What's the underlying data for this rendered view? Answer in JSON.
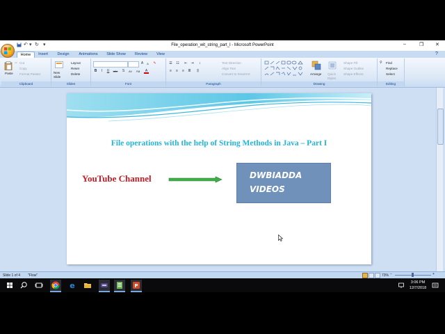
{
  "window": {
    "title": "File_operation_wit_string_part_I - Microsoft PowerPoint",
    "controls": {
      "minimize": "–",
      "maximize": "❐",
      "close": "✕"
    }
  },
  "tabs": [
    "Home",
    "Insert",
    "Design",
    "Animations",
    "Slide Show",
    "Review",
    "View"
  ],
  "ribbon": {
    "clipboard": {
      "label": "Clipboard",
      "paste": "Paste",
      "cut": "Cut",
      "copy": "Copy",
      "format_painter": "Format Painter"
    },
    "slides": {
      "label": "Slides",
      "new_slide": "New Slide",
      "layout": "Layout",
      "reset": "Reset",
      "delete": "Delete"
    },
    "font": {
      "label": "Font",
      "bold": "B",
      "italic": "I",
      "underline": "U",
      "strike": "abe",
      "shadow": "S",
      "spacing": "AV",
      "case": "Aa",
      "grow": "A",
      "shrink": "A"
    },
    "paragraph": {
      "label": "Paragraph",
      "text_direction": "Text Direction",
      "align_text": "Align Text",
      "smartart": "Convert to SmartArt"
    },
    "drawing": {
      "label": "Drawing",
      "arrange": "Arrange",
      "quick_styles": "Quick Styles",
      "shape_fill": "Shape Fill",
      "shape_outline": "Shape Outline",
      "shape_effects": "Shape Effects"
    },
    "editing": {
      "label": "Editing",
      "find": "Find",
      "replace": "Replace",
      "select": "Select"
    }
  },
  "slide": {
    "title": "File operations with the help of String Methods in Java – Part I",
    "youtube_label": "YouTube Channel",
    "channel_line1": "DWBIADDA",
    "channel_line2": "VIDEOS"
  },
  "status": {
    "slide_info": "Slide 1 of 4",
    "theme": "\"Flow\"",
    "zoom": "73%"
  },
  "taskbar": {
    "time": "3:06 PM",
    "date": "12/7/2018"
  },
  "colors": {
    "title_cyan": "#22b5d8",
    "youtube_red": "#c41b24",
    "box_blue": "#6f91ba",
    "arrow_green": "#3fae49"
  }
}
